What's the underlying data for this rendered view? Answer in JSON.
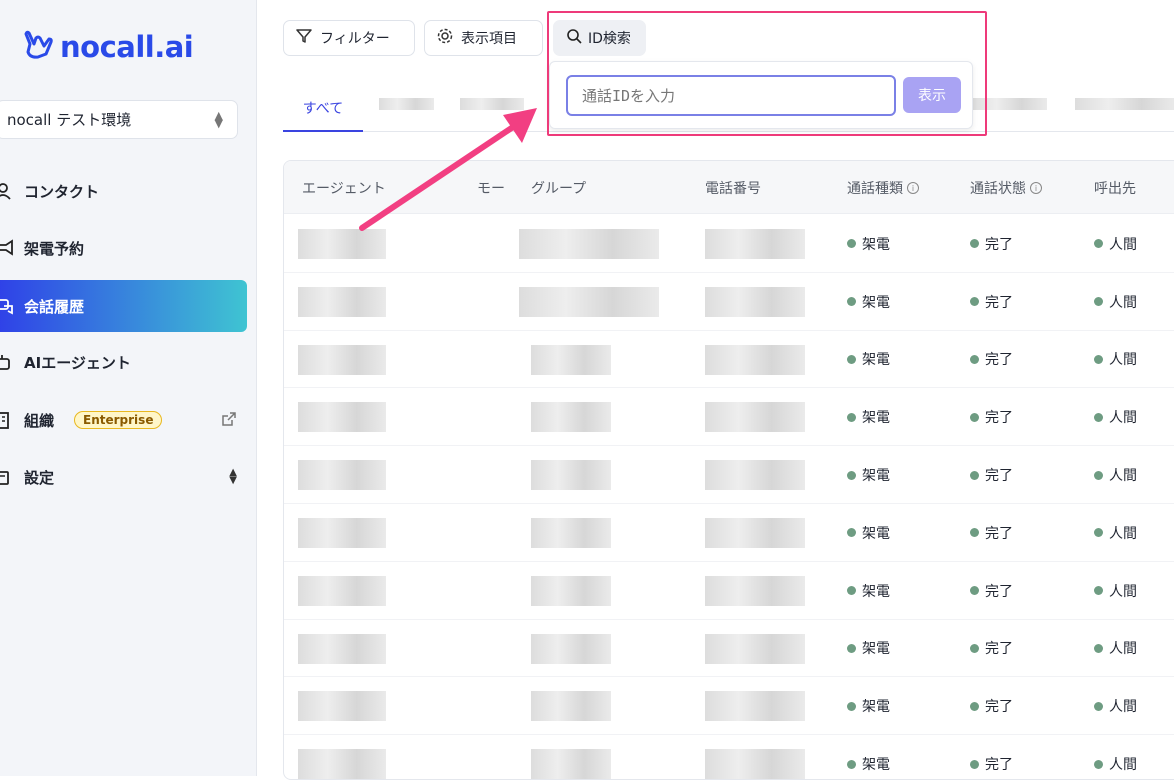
{
  "logo": {
    "text": "nocall.ai"
  },
  "sidebar": {
    "env_label": "nocall テスト環境",
    "items": [
      {
        "label": "コンタクト",
        "icon": "user-icon"
      },
      {
        "label": "架電予約",
        "icon": "megaphone-icon"
      },
      {
        "label": "会話履歴",
        "icon": "chat-icon",
        "active": true
      },
      {
        "label": "AIエージェント",
        "icon": "robot-icon"
      },
      {
        "label": "組織",
        "icon": "building-icon",
        "badge": "Enterprise"
      },
      {
        "label": "設定",
        "icon": "settings-icon"
      }
    ]
  },
  "toolbar": {
    "filter_label": "フィルター",
    "columns_label": "表示項目",
    "idsearch_label": "ID検索"
  },
  "tabs": {
    "all_label": "すべて"
  },
  "search_popover": {
    "placeholder": "通話IDを入力",
    "show_label": "表示"
  },
  "table": {
    "headers": [
      "エージェント",
      "モー",
      "グループ",
      "電話番号",
      "通話種類",
      "通話状態",
      "呼出先"
    ],
    "rows": [
      {
        "type": "架電",
        "status": "完了",
        "target": "人間"
      },
      {
        "type": "架電",
        "status": "完了",
        "target": "人間"
      },
      {
        "type": "架電",
        "status": "完了",
        "target": "人間"
      },
      {
        "type": "架電",
        "status": "完了",
        "target": "人間"
      },
      {
        "type": "架電",
        "status": "完了",
        "target": "人間"
      },
      {
        "type": "架電",
        "status": "完了",
        "target": "人間"
      },
      {
        "type": "架電",
        "status": "完了",
        "target": "人間"
      },
      {
        "type": "架電",
        "status": "完了",
        "target": "人間"
      },
      {
        "type": "架電",
        "status": "完了",
        "target": "人間"
      },
      {
        "type": "架電",
        "status": "完了",
        "target": "人間"
      }
    ]
  },
  "colors": {
    "brand": "#2a4ae8",
    "highlight": "#ee3a7a",
    "status_dot": "#6e9c82"
  }
}
